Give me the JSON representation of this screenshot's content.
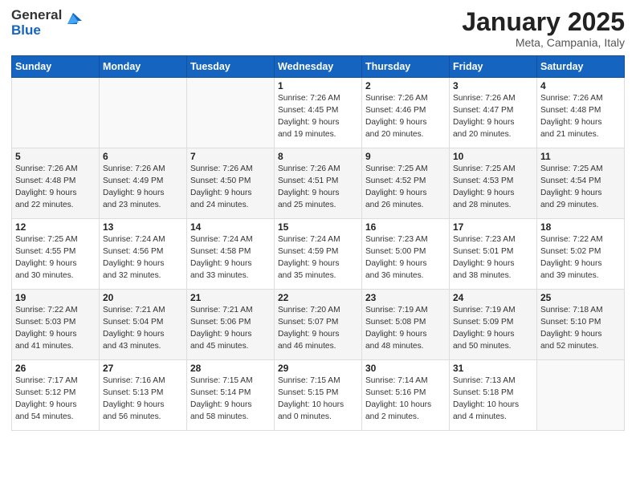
{
  "logo": {
    "general": "General",
    "blue": "Blue"
  },
  "header": {
    "month": "January 2025",
    "location": "Meta, Campania, Italy"
  },
  "days_of_week": [
    "Sunday",
    "Monday",
    "Tuesday",
    "Wednesday",
    "Thursday",
    "Friday",
    "Saturday"
  ],
  "weeks": [
    [
      {
        "day": "",
        "info": ""
      },
      {
        "day": "",
        "info": ""
      },
      {
        "day": "",
        "info": ""
      },
      {
        "day": "1",
        "info": "Sunrise: 7:26 AM\nSunset: 4:45 PM\nDaylight: 9 hours\nand 19 minutes."
      },
      {
        "day": "2",
        "info": "Sunrise: 7:26 AM\nSunset: 4:46 PM\nDaylight: 9 hours\nand 20 minutes."
      },
      {
        "day": "3",
        "info": "Sunrise: 7:26 AM\nSunset: 4:47 PM\nDaylight: 9 hours\nand 20 minutes."
      },
      {
        "day": "4",
        "info": "Sunrise: 7:26 AM\nSunset: 4:48 PM\nDaylight: 9 hours\nand 21 minutes."
      }
    ],
    [
      {
        "day": "5",
        "info": "Sunrise: 7:26 AM\nSunset: 4:48 PM\nDaylight: 9 hours\nand 22 minutes."
      },
      {
        "day": "6",
        "info": "Sunrise: 7:26 AM\nSunset: 4:49 PM\nDaylight: 9 hours\nand 23 minutes."
      },
      {
        "day": "7",
        "info": "Sunrise: 7:26 AM\nSunset: 4:50 PM\nDaylight: 9 hours\nand 24 minutes."
      },
      {
        "day": "8",
        "info": "Sunrise: 7:26 AM\nSunset: 4:51 PM\nDaylight: 9 hours\nand 25 minutes."
      },
      {
        "day": "9",
        "info": "Sunrise: 7:25 AM\nSunset: 4:52 PM\nDaylight: 9 hours\nand 26 minutes."
      },
      {
        "day": "10",
        "info": "Sunrise: 7:25 AM\nSunset: 4:53 PM\nDaylight: 9 hours\nand 28 minutes."
      },
      {
        "day": "11",
        "info": "Sunrise: 7:25 AM\nSunset: 4:54 PM\nDaylight: 9 hours\nand 29 minutes."
      }
    ],
    [
      {
        "day": "12",
        "info": "Sunrise: 7:25 AM\nSunset: 4:55 PM\nDaylight: 9 hours\nand 30 minutes."
      },
      {
        "day": "13",
        "info": "Sunrise: 7:24 AM\nSunset: 4:56 PM\nDaylight: 9 hours\nand 32 minutes."
      },
      {
        "day": "14",
        "info": "Sunrise: 7:24 AM\nSunset: 4:58 PM\nDaylight: 9 hours\nand 33 minutes."
      },
      {
        "day": "15",
        "info": "Sunrise: 7:24 AM\nSunset: 4:59 PM\nDaylight: 9 hours\nand 35 minutes."
      },
      {
        "day": "16",
        "info": "Sunrise: 7:23 AM\nSunset: 5:00 PM\nDaylight: 9 hours\nand 36 minutes."
      },
      {
        "day": "17",
        "info": "Sunrise: 7:23 AM\nSunset: 5:01 PM\nDaylight: 9 hours\nand 38 minutes."
      },
      {
        "day": "18",
        "info": "Sunrise: 7:22 AM\nSunset: 5:02 PM\nDaylight: 9 hours\nand 39 minutes."
      }
    ],
    [
      {
        "day": "19",
        "info": "Sunrise: 7:22 AM\nSunset: 5:03 PM\nDaylight: 9 hours\nand 41 minutes."
      },
      {
        "day": "20",
        "info": "Sunrise: 7:21 AM\nSunset: 5:04 PM\nDaylight: 9 hours\nand 43 minutes."
      },
      {
        "day": "21",
        "info": "Sunrise: 7:21 AM\nSunset: 5:06 PM\nDaylight: 9 hours\nand 45 minutes."
      },
      {
        "day": "22",
        "info": "Sunrise: 7:20 AM\nSunset: 5:07 PM\nDaylight: 9 hours\nand 46 minutes."
      },
      {
        "day": "23",
        "info": "Sunrise: 7:19 AM\nSunset: 5:08 PM\nDaylight: 9 hours\nand 48 minutes."
      },
      {
        "day": "24",
        "info": "Sunrise: 7:19 AM\nSunset: 5:09 PM\nDaylight: 9 hours\nand 50 minutes."
      },
      {
        "day": "25",
        "info": "Sunrise: 7:18 AM\nSunset: 5:10 PM\nDaylight: 9 hours\nand 52 minutes."
      }
    ],
    [
      {
        "day": "26",
        "info": "Sunrise: 7:17 AM\nSunset: 5:12 PM\nDaylight: 9 hours\nand 54 minutes."
      },
      {
        "day": "27",
        "info": "Sunrise: 7:16 AM\nSunset: 5:13 PM\nDaylight: 9 hours\nand 56 minutes."
      },
      {
        "day": "28",
        "info": "Sunrise: 7:15 AM\nSunset: 5:14 PM\nDaylight: 9 hours\nand 58 minutes."
      },
      {
        "day": "29",
        "info": "Sunrise: 7:15 AM\nSunset: 5:15 PM\nDaylight: 10 hours\nand 0 minutes."
      },
      {
        "day": "30",
        "info": "Sunrise: 7:14 AM\nSunset: 5:16 PM\nDaylight: 10 hours\nand 2 minutes."
      },
      {
        "day": "31",
        "info": "Sunrise: 7:13 AM\nSunset: 5:18 PM\nDaylight: 10 hours\nand 4 minutes."
      },
      {
        "day": "",
        "info": ""
      }
    ]
  ]
}
